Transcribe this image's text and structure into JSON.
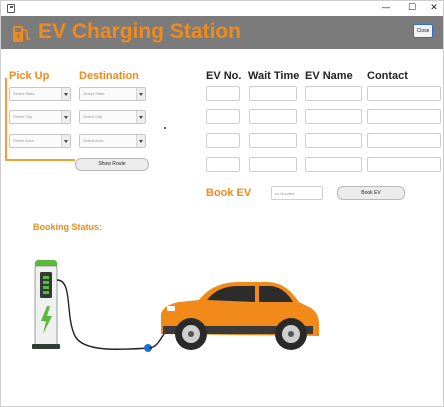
{
  "window": {
    "controls": {
      "minimize": "—",
      "maximize": "☐",
      "close": "✕"
    }
  },
  "header": {
    "title": "EV Charging Station",
    "close_label": "Close"
  },
  "pickup": {
    "heading": "Pick Up",
    "state_placeholder": "Select State",
    "city_placeholder": "Select City",
    "area_placeholder": "Select Area"
  },
  "destination": {
    "heading": "Destination",
    "state_placeholder": "Select State",
    "city_placeholder": "Select City",
    "area_placeholder": "Select Area"
  },
  "show_button": "Show Route",
  "table": {
    "columns": [
      "EV No.",
      "Wait Time",
      "EV Name",
      "Contact"
    ],
    "rows": [
      [
        "",
        "",
        "",
        ""
      ],
      [
        "",
        "",
        "",
        ""
      ],
      [
        "",
        "",
        "",
        ""
      ],
      [
        "",
        "",
        "",
        ""
      ]
    ]
  },
  "book": {
    "label": "Book EV",
    "input_placeholder": "ev Number",
    "button": "Book EV"
  },
  "booking_status_label": "Booking Status:",
  "colors": {
    "accent_orange": "#f08a1a",
    "header_gray": "#7b7b7b",
    "car_orange": "#f28a1a",
    "charger_green": "#5ab83a"
  }
}
